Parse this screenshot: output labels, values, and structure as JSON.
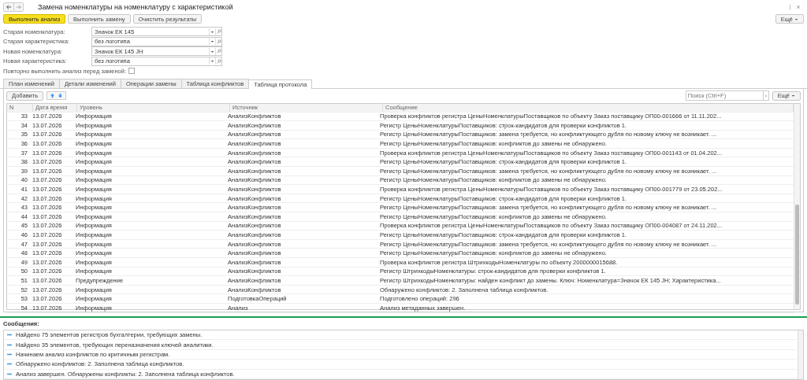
{
  "window": {
    "title": "Замена номенклатуры на номенклатуру с характеристикой",
    "more": "Ещё"
  },
  "actions": [
    {
      "label": "Выполнить анализ",
      "primary": true
    },
    {
      "label": "Выполнить замену",
      "primary": false
    },
    {
      "label": "Очистить результаты",
      "primary": false
    }
  ],
  "fields": [
    {
      "label": "Старая номенклатура:",
      "value": "Значок ЕК 145"
    },
    {
      "label": "Старая характеристика:",
      "value": "без логотипа"
    },
    {
      "label": "Новая номенклатура:",
      "value": "Значок ЕК 145 JH"
    },
    {
      "label": "Новая характеристика:",
      "value": "без логотипа"
    }
  ],
  "recheck": {
    "label": "Повторно выполнить анализ перед заменой:",
    "checked": false
  },
  "tabs": [
    {
      "label": "План изменений",
      "selected": false
    },
    {
      "label": "Детали изменений",
      "selected": false
    },
    {
      "label": "Операции замены",
      "selected": false
    },
    {
      "label": "Таблица конфликтов",
      "selected": false
    },
    {
      "label": "Таблица протокола",
      "selected": true
    }
  ],
  "toolbar": {
    "add": "Добавить",
    "search": {
      "placeholder": "Поиск (Ctrl+F)"
    },
    "more": "Ещё"
  },
  "table": {
    "columns": [
      "N",
      "Дата время",
      "Уровень",
      "Источник",
      "Сообщение"
    ],
    "rows": [
      [
        "33",
        "13.07.2026",
        "Информация",
        "АнализКонфликтов",
        "Проверка конфликтов регистра ЦеныНоменклатурыПоставщиков по объекту Заказ поставщику ОП00-001666 от 11.11.202..."
      ],
      [
        "34",
        "13.07.2026",
        "Информация",
        "АнализКонфликтов",
        "Регистр ЦеныНоменклатурыПоставщиков: строк-кандидатов для проверки конфликтов 1."
      ],
      [
        "35",
        "13.07.2026",
        "Информация",
        "АнализКонфликтов",
        "Регистр ЦеныНоменклатурыПоставщиков: замена требуется, но конфликтующего дубля по новому ключу не возникает. ..."
      ],
      [
        "36",
        "13.07.2026",
        "Информация",
        "АнализКонфликтов",
        "Регистр ЦеныНоменклатурыПоставщиков: конфликтов до замены не обнаружено."
      ],
      [
        "37",
        "13.07.2026",
        "Информация",
        "АнализКонфликтов",
        "Проверка конфликтов регистра ЦеныНоменклатурыПоставщиков по объекту Заказ поставщику ОП00-001143 от 01.04.202..."
      ],
      [
        "38",
        "13.07.2026",
        "Информация",
        "АнализКонфликтов",
        "Регистр ЦеныНоменклатурыПоставщиков: строк-кандидатов для проверки конфликтов 1."
      ],
      [
        "39",
        "13.07.2026",
        "Информация",
        "АнализКонфликтов",
        "Регистр ЦеныНоменклатурыПоставщиков: замена требуется, но конфликтующего дубля по новому ключу не возникает. ..."
      ],
      [
        "40",
        "13.07.2026",
        "Информация",
        "АнализКонфликтов",
        "Регистр ЦеныНоменклатурыПоставщиков: конфликтов до замены не обнаружено."
      ],
      [
        "41",
        "13.07.2026",
        "Информация",
        "АнализКонфликтов",
        "Проверка конфликтов регистра ЦеныНоменклатурыПоставщиков по объекту Заказ поставщику ОП00-001779 от 23.05.202..."
      ],
      [
        "42",
        "13.07.2026",
        "Информация",
        "АнализКонфликтов",
        "Регистр ЦеныНоменклатурыПоставщиков: строк-кандидатов для проверки конфликтов 1."
      ],
      [
        "43",
        "13.07.2026",
        "Информация",
        "АнализКонфликтов",
        "Регистр ЦеныНоменклатурыПоставщиков: замена требуется, но конфликтующего дубля по новому ключу не возникает. ..."
      ],
      [
        "44",
        "13.07.2026",
        "Информация",
        "АнализКонфликтов",
        "Регистр ЦеныНоменклатурыПоставщиков: конфликтов до замены не обнаружено."
      ],
      [
        "45",
        "13.07.2026",
        "Информация",
        "АнализКонфликтов",
        "Проверка конфликтов регистра ЦеныНоменклатурыПоставщиков по объекту Заказ поставщику ОП00-004087 от 24.11.202..."
      ],
      [
        "46",
        "13.07.2026",
        "Информация",
        "АнализКонфликтов",
        "Регистр ЦеныНоменклатурыПоставщиков: строк-кандидатов для проверки конфликтов 1."
      ],
      [
        "47",
        "13.07.2026",
        "Информация",
        "АнализКонфликтов",
        "Регистр ЦеныНоменклатурыПоставщиков: замена требуется, но конфликтующего дубля по новому ключу не возникает. ..."
      ],
      [
        "48",
        "13.07.2026",
        "Информация",
        "АнализКонфликтов",
        "Регистр ЦеныНоменклатурыПоставщиков: конфликтов до замены не обнаружено."
      ],
      [
        "49",
        "13.07.2026",
        "Информация",
        "АнализКонфликтов",
        "Проверка конфликтов регистра ШтрихкодыНоменклатуры по объекту 2000000015688."
      ],
      [
        "50",
        "13.07.2026",
        "Информация",
        "АнализКонфликтов",
        "Регистр ШтрихкодыНоменклатуры: строк-кандидатов для проверки конфликтов 1."
      ],
      [
        "51",
        "13.07.2026",
        "Предупреждение",
        "АнализКонфликтов",
        "Регистр ШтрихкодыНоменклатуры: найден конфликт до замены. Ключ: Номенклатура=Значок ЕК 145 JH; Характеристика..."
      ],
      [
        "52",
        "13.07.2026",
        "Информация",
        "АнализКонфликтов",
        "Обнаружено конфликтов: 2. Заполнена таблица конфликтов."
      ],
      [
        "53",
        "13.07.2026",
        "Информация",
        "ПодготовкаОпераций",
        "Подготовлено операций: 296"
      ],
      [
        "54",
        "13.07.2026",
        "Информация",
        "Анализ",
        "Анализ метаданных завершен."
      ]
    ]
  },
  "messages": {
    "title": "Сообщения:",
    "items": [
      "Найдено 75 элементов регистров бухгалтерии, требующих замены.",
      "Найдено 35 элементов, требующих переназначения ключей аналитики.",
      "Начинаем анализ конфликтов по критичным регистрам.",
      "Обнаружено конфликтов: 2. Заполнена таблица конфликтов.",
      "Анализ завершен. Обнаружены конфликты: 2. Заполнена таблица конфликтов."
    ]
  }
}
